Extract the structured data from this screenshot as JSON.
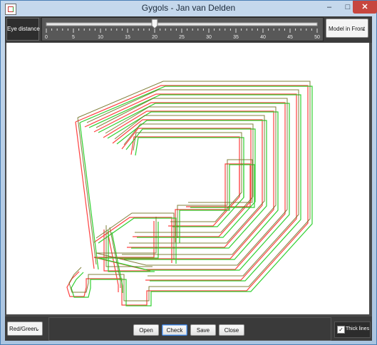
{
  "window": {
    "title": "Gygols - Jan van Delden",
    "minimize_glyph": "–",
    "maximize_glyph": "□",
    "close_glyph": "✕"
  },
  "top_bar": {
    "eye_distance_label": "Eye distance",
    "slider": {
      "min": 0,
      "max": 50,
      "value": 20,
      "major_tick_step": 5,
      "tick_labels": [
        "0",
        "5",
        "10",
        "15",
        "20",
        "25",
        "30",
        "35",
        "40",
        "45",
        "50"
      ]
    },
    "view_mode_select": {
      "selected": "Model in Front",
      "chevron_icon": "chevron-down-icon"
    }
  },
  "bottom_bar": {
    "color_mode_select": {
      "selected": "Red/Green",
      "chevron_icon": "chevron-down-icon"
    },
    "buttons": {
      "open_label": "Open",
      "check_label": "Check",
      "save_label": "Save",
      "close_label": "Close"
    },
    "thick_lines": {
      "label": "Thick lines",
      "checked": true,
      "check_glyph": "✓"
    }
  },
  "colors": {
    "left_eye_stroke": "#ff4040",
    "right_eye_stroke": "#30d030",
    "overlap_stroke": "#6b6b1a",
    "canvas_background": "#ffffff",
    "panel_background": "#3c3c3c"
  }
}
